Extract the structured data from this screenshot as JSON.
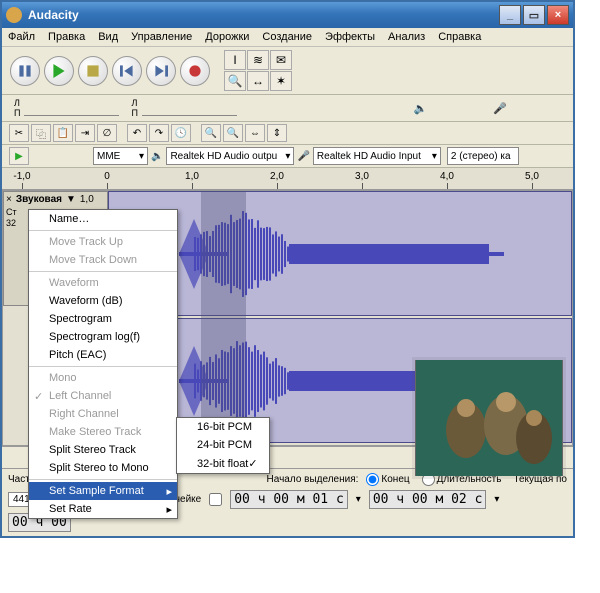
{
  "window": {
    "title": "Audacity"
  },
  "menubar": [
    "Файл",
    "Правка",
    "Вид",
    "Управление",
    "Дорожки",
    "Создание",
    "Эффекты",
    "Анализ",
    "Справка"
  ],
  "transport": {
    "pause": "pause",
    "play": "play",
    "stop": "stop",
    "skip_start": "skip-start",
    "skip_end": "skip-end",
    "record": "record"
  },
  "tools": [
    "I",
    "≋",
    "✉",
    "🔍",
    "↔",
    "✶"
  ],
  "meters": {
    "left": "Л\nП",
    "right": "Л\nП"
  },
  "device": {
    "host": "MME",
    "output": "Realtek HD Audio outpu",
    "input": "Realtek HD Audio Input",
    "channels": "2 (стерео) ка"
  },
  "ruler": {
    "ticks": [
      "-1,0",
      "0",
      "1,0",
      "2,0",
      "3,0",
      "4,0",
      "5,0"
    ]
  },
  "track": {
    "name": "Звуковая",
    "rate": "1,0",
    "hdr_x": "×",
    "hdr_down": "▼",
    "lines": [
      "Ст",
      "32",
      "+"
    ]
  },
  "ctx": [
    {
      "t": "Name…",
      "dis": false
    },
    {
      "sep": true
    },
    {
      "t": "Move Track Up",
      "dis": true
    },
    {
      "t": "Move Track Down",
      "dis": true
    },
    {
      "sep": true
    },
    {
      "t": "Waveform",
      "dis": true
    },
    {
      "t": "Waveform (dB)",
      "dis": false
    },
    {
      "t": "Spectrogram",
      "dis": false
    },
    {
      "t": "Spectrogram log(f)",
      "dis": false
    },
    {
      "t": "Pitch (EAC)",
      "dis": false
    },
    {
      "sep": true
    },
    {
      "t": "Mono",
      "dis": true
    },
    {
      "t": "Left Channel",
      "dis": true,
      "chk": true
    },
    {
      "t": "Right Channel",
      "dis": true
    },
    {
      "t": "Make Stereo Track",
      "dis": true
    },
    {
      "t": "Split Stereo Track",
      "dis": false
    },
    {
      "t": "Split Stereo to Mono",
      "dis": false
    },
    {
      "sep": true
    },
    {
      "t": "Set Sample Format",
      "hi": true,
      "sub": true
    },
    {
      "t": "Set Rate",
      "sub": true
    }
  ],
  "sub": [
    {
      "t": "16-bit PCM"
    },
    {
      "t": "24-bit PCM"
    },
    {
      "t": "32-bit float",
      "chk": true
    }
  ],
  "bottom": {
    "freq_label": "Частота проекта (Гц):",
    "freq": "44100",
    "snap_label": "Прилипать к линейке",
    "sel_start_label": "Начало выделения:",
    "end_radio": "Конец",
    "len_radio": "Длительность",
    "current_label": "Текущая по",
    "tc1": "00 ч 00 м 01 с",
    "tc2": "00 ч 00 м 02 с",
    "tc3": "00 ч 00"
  }
}
